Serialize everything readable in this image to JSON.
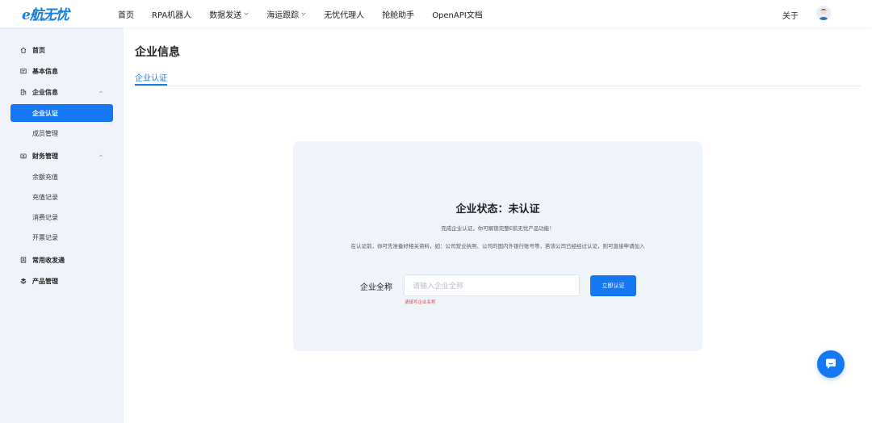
{
  "logo": {
    "brand": "e航无忧",
    "domain": "ehw56.com"
  },
  "nav": {
    "items": [
      {
        "label": "首页",
        "has_dropdown": false
      },
      {
        "label": "RPA机器人",
        "has_dropdown": false
      },
      {
        "label": "数据发送",
        "has_dropdown": true
      },
      {
        "label": "海运跟踪",
        "has_dropdown": true
      },
      {
        "label": "无忧代理人",
        "has_dropdown": false
      },
      {
        "label": "抢舱助手",
        "has_dropdown": false
      },
      {
        "label": "OpenAPI文档",
        "has_dropdown": false
      }
    ],
    "right_label": "关于"
  },
  "sidebar": {
    "items": [
      {
        "label": "首页",
        "icon": "home-icon"
      },
      {
        "label": "基本信息",
        "icon": "id-card-icon"
      },
      {
        "label": "企业信息",
        "icon": "building-icon",
        "expanded": true
      },
      {
        "label": "企业认证",
        "sub": true,
        "active": true
      },
      {
        "label": "成员管理",
        "sub": true
      },
      {
        "label": "财务管理",
        "icon": "wallet-icon",
        "expanded": true
      },
      {
        "label": "余额充值",
        "sub": true
      },
      {
        "label": "充值记录",
        "sub": true
      },
      {
        "label": "消费记录",
        "sub": true
      },
      {
        "label": "开票记录",
        "sub": true
      },
      {
        "label": "常用收发通",
        "icon": "contacts-icon"
      },
      {
        "label": "产品管理",
        "icon": "layers-icon"
      }
    ]
  },
  "main": {
    "title": "企业信息",
    "tabs": [
      {
        "label": "企业认证",
        "active": true
      }
    ],
    "card": {
      "status": "企业状态：未认证",
      "desc1": "完成企业认证，你可解锁完整E航无忧产品功能！",
      "desc2": "在认证前，你可先准备好相关资料，如：公司营业执照、公司的国内外银行账号等，若该公司已经经过认证，则可直接申请加入",
      "field_label": "企业全称",
      "field_placeholder": "请输入企业全称",
      "field_value": "",
      "field_error": "请填写企业名称",
      "submit_label": "立即认证"
    }
  },
  "colors": {
    "accent": "#1677f2",
    "sidebar_bg": "#f0f4fa",
    "card_bg": "#eff4fb",
    "error": "#e8403f"
  }
}
